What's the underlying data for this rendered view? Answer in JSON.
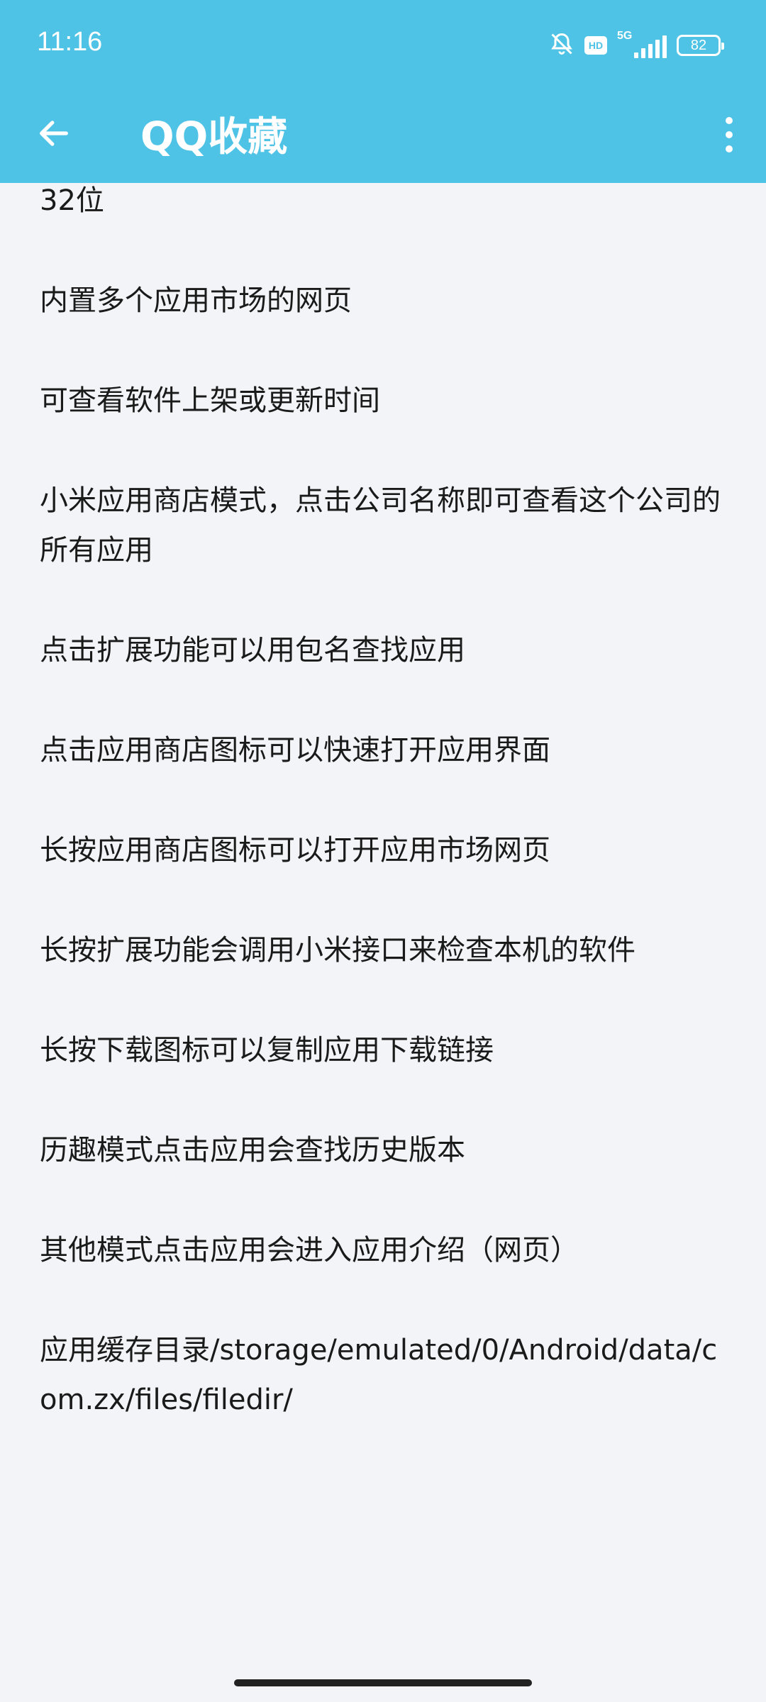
{
  "status_bar": {
    "time": "11:16",
    "network_label": "5G",
    "hd_label": "HD",
    "battery": "82",
    "icons": [
      "bell-muted-icon",
      "hd-icon",
      "5g-signal-icon",
      "battery-icon"
    ]
  },
  "app_bar": {
    "title": "QQ收藏",
    "back_icon": "arrow-left-icon",
    "more_icon": "more-vertical-icon"
  },
  "content": {
    "lines": [
      "32位",
      "内置多个应用市场的网页",
      "可查看软件上架或更新时间",
      "小米应用商店模式，点击公司名称即可查看这个公司的所有应用",
      "点击扩展功能可以用包名查找应用",
      "点击应用商店图标可以快速打开应用界面",
      "长按应用商店图标可以打开应用市场网页",
      "长按扩展功能会调用小米接口来检查本机的软件",
      "长按下载图标可以复制应用下载链接",
      "历趣模式点击应用会查找历史版本",
      "其他模式点击应用会进入应用介绍（网页）",
      "应用缓存目录/storage/emulated/0/Android/data/com.zx/files/filedir/"
    ]
  },
  "colors": {
    "app_bar": "#4fc3e6",
    "background": "#f3f4f8",
    "text": "#1a1a1a"
  }
}
